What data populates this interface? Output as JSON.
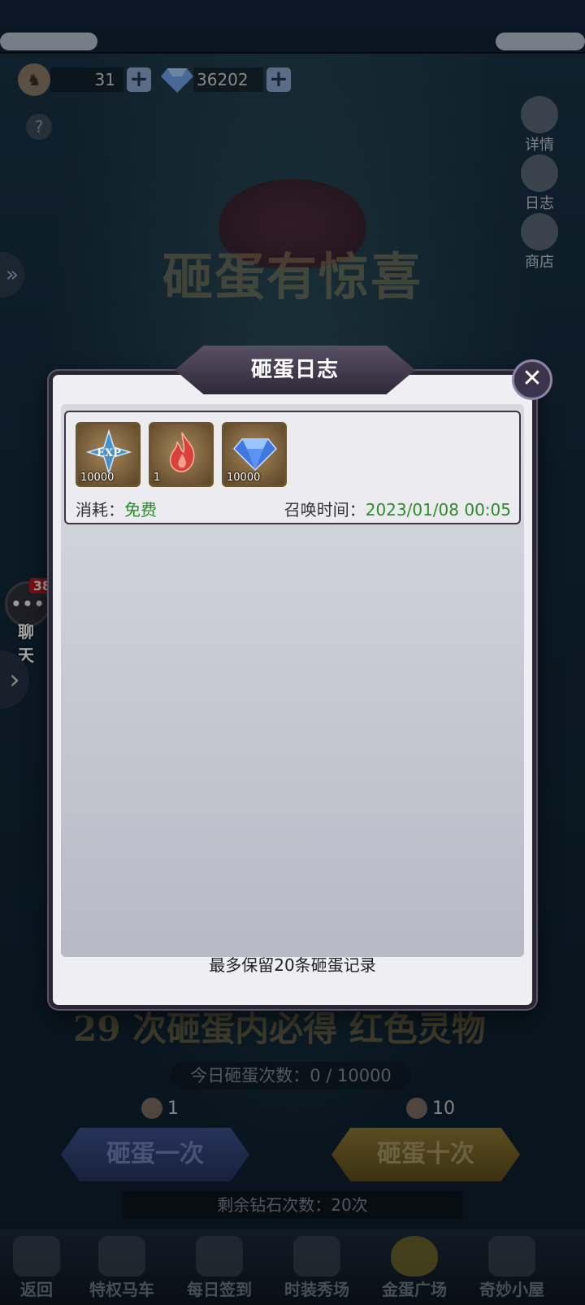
{
  "resources": {
    "stamina_value": "31",
    "diamond_value": "36202",
    "plus_label": "+"
  },
  "side_menu": [
    {
      "label": "详情",
      "icon": "scroll-icon"
    },
    {
      "label": "日志",
      "icon": "log-icon"
    },
    {
      "label": "商店",
      "icon": "shop-icon"
    }
  ],
  "event_title": "砸蛋有惊喜",
  "chat": {
    "label": "聊 天",
    "badge": "38"
  },
  "banner_text": "29 次砸蛋内必得 红色灵物",
  "today_count": "今日砸蛋次数：0 / 10000",
  "smash_once": {
    "cost": "1",
    "label": "砸蛋一次"
  },
  "smash_ten": {
    "cost": "10",
    "label": "砸蛋十次"
  },
  "remaining": "剩余钻石次数：20次",
  "bottom_nav": {
    "back": "返回",
    "items": [
      {
        "label": "特权马车",
        "icon": "carriage-icon"
      },
      {
        "label": "每日签到",
        "icon": "signin-icon"
      },
      {
        "label": "时装秀场",
        "icon": "costume-icon"
      },
      {
        "label": "金蛋广场",
        "icon": "golden-egg-icon",
        "active": true
      },
      {
        "label": "奇妙小屋",
        "icon": "house-icon"
      }
    ]
  },
  "modal": {
    "title": "砸蛋日志",
    "records": [
      {
        "items": [
          {
            "name": "exp-item",
            "qty": "10000",
            "icon": "exp-star-icon"
          },
          {
            "name": "fire-item",
            "qty": "1",
            "icon": "flame-icon"
          },
          {
            "name": "diamond-item",
            "qty": "10000",
            "icon": "diamond-icon"
          }
        ],
        "cost_label": "消耗：",
        "cost_value": "免费",
        "time_label": "召唤时间：",
        "time_value": "2023/01/08 00:05"
      }
    ],
    "footer_note": "最多保留20条砸蛋记录"
  }
}
